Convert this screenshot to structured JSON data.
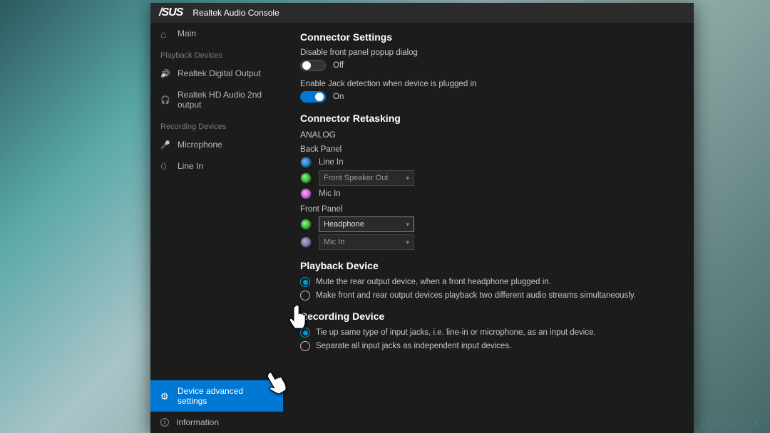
{
  "titlebar": {
    "brand": "/SUS",
    "title": "Realtek Audio Console"
  },
  "sidebar": {
    "main": "Main",
    "sections": {
      "playback": "Playback Devices",
      "recording": "Recording Devices"
    },
    "items": {
      "digital_out": "Realtek Digital Output",
      "hd_audio": "Realtek HD Audio 2nd output",
      "microphone": "Microphone",
      "line_in": "Line In",
      "dev_adv": "Device advanced settings",
      "information": "Information"
    }
  },
  "main": {
    "connector_settings": {
      "heading": "Connector Settings",
      "disable_popup": {
        "label": "Disable front panel popup dialog",
        "state_off": "Off"
      },
      "jack_detect": {
        "label": "Enable Jack detection when device is plugged in",
        "state_on": "On"
      }
    },
    "retasking": {
      "heading": "Connector Retasking",
      "analog": "ANALOG",
      "back_panel": "Back Panel",
      "front_panel": "Front Panel",
      "jacks": {
        "line_in": "Line In",
        "front_speaker": "Front Speaker Out",
        "mic_in": "Mic In",
        "headphone": "Headphone",
        "mic_in2": "Mic In"
      }
    },
    "playback_device": {
      "heading": "Playback Device",
      "opt1": "Mute the rear output device, when a front headphone plugged in.",
      "opt2": "Make front and rear output devices playback two different audio streams simultaneously."
    },
    "recording_device": {
      "heading": "Recording Device",
      "opt1": "Tie up same type of input jacks, i.e. line-in or microphone, as an input device.",
      "opt2": "Separate all input jacks as independent input devices."
    }
  },
  "watermark": "UGETFIX"
}
